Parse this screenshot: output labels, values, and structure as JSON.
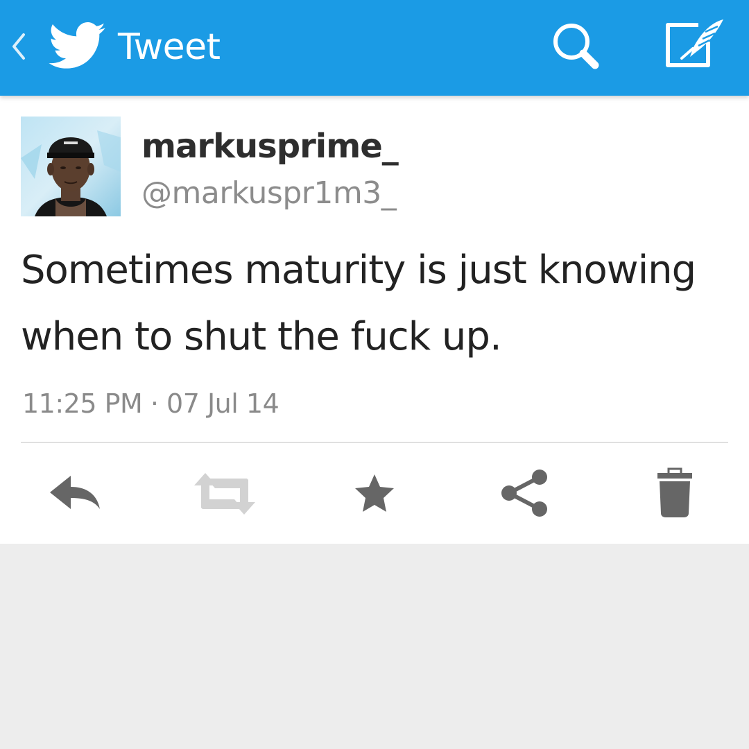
{
  "app_bar": {
    "title": "Tweet",
    "background_color": "#1b9be5",
    "icons": [
      "back-chevron-icon",
      "twitter-bird-icon",
      "search-icon",
      "compose-icon"
    ]
  },
  "tweet": {
    "display_name": "markusprime_",
    "handle": "@markuspr1m3_",
    "text": "Sometimes maturity is just knowing when to shut the fuck up.",
    "timestamp": "11:25 PM · 07 Jul 14"
  },
  "actions": [
    {
      "name": "reply",
      "icon": "reply-icon"
    },
    {
      "name": "retweet",
      "icon": "retweet-icon",
      "state": "disabled"
    },
    {
      "name": "favorite",
      "icon": "star-icon"
    },
    {
      "name": "share",
      "icon": "share-icon"
    },
    {
      "name": "delete",
      "icon": "trash-icon"
    }
  ],
  "colors": {
    "icon_active": "#666666",
    "icon_disabled": "#d2d2d2",
    "page_background": "#ededed"
  }
}
